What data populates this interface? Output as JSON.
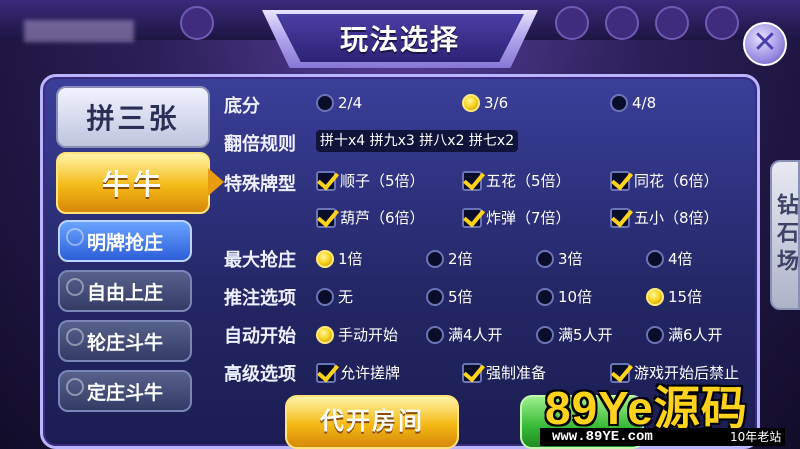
{
  "window": {
    "title": "玩法选择",
    "close_label": "✕"
  },
  "sidebar": {
    "top_tabs": [
      {
        "label": "拼三张",
        "selected": false
      },
      {
        "label": "牛牛",
        "selected": true
      }
    ],
    "sub_tabs": [
      {
        "label": "明牌抢庄",
        "selected": true
      },
      {
        "label": "自由上庄",
        "selected": false
      },
      {
        "label": "轮庄斗牛",
        "selected": false
      },
      {
        "label": "定庄斗牛",
        "selected": false
      }
    ]
  },
  "side_tab": {
    "label": "钻石场"
  },
  "options": {
    "base_score": {
      "label": "底分",
      "choices": [
        "2/4",
        "3/6",
        "4/8"
      ],
      "selected": "3/6"
    },
    "double_rule": {
      "label": "翻倍规则",
      "value": "拼十x4 拼九x3 拼八x2 拼七x2"
    },
    "special": {
      "label": "特殊牌型",
      "items": [
        {
          "label": "顺子（5倍）",
          "checked": true
        },
        {
          "label": "五花（5倍）",
          "checked": true
        },
        {
          "label": "同花（6倍）",
          "checked": true
        },
        {
          "label": "葫芦（6倍）",
          "checked": true
        },
        {
          "label": "炸弹（7倍）",
          "checked": true
        },
        {
          "label": "五小（8倍）",
          "checked": true
        }
      ]
    },
    "max_grab": {
      "label": "最大抢庄",
      "choices": [
        "1倍",
        "2倍",
        "3倍",
        "4倍"
      ],
      "selected": "1倍"
    },
    "push_bet": {
      "label": "推注选项",
      "choices": [
        "无",
        "5倍",
        "10倍",
        "15倍"
      ],
      "selected": "15倍"
    },
    "auto_start": {
      "label": "自动开始",
      "choices": [
        "手动开始",
        "满4人开",
        "满5人开",
        "满6人开"
      ],
      "selected": "手动开始"
    },
    "advanced": {
      "label": "高级选项",
      "items": [
        {
          "label": "允许搓牌",
          "checked": true
        },
        {
          "label": "强制准备",
          "checked": true
        },
        {
          "label": "游戏开始后禁止",
          "checked": true
        }
      ]
    }
  },
  "buttons": {
    "open_room": "代开房间"
  },
  "watermark": {
    "brand": "89Ye源码",
    "url": "www.89YE.com",
    "sub": "10年老站"
  },
  "colors": {
    "accent_gold": "#f4b915",
    "panel": "#232664",
    "selected_blue": "#2c5fd8"
  }
}
